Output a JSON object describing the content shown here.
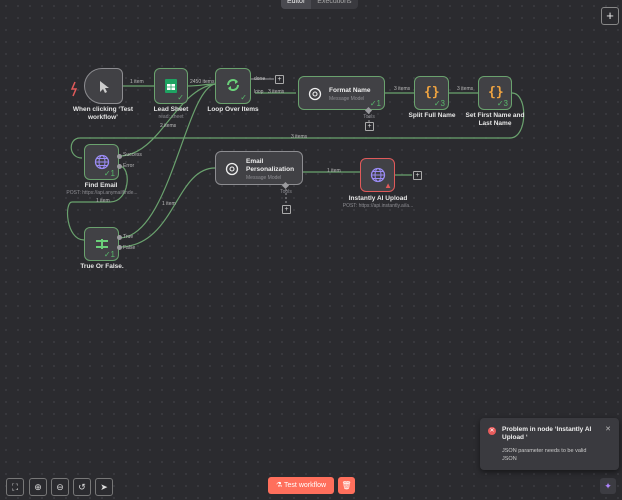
{
  "tabs": [
    "Editor",
    "Executions"
  ],
  "nodes": {
    "trigger": {
      "label": "When clicking ‘Test workflow’",
      "icon": "cursor-icon"
    },
    "lead_sheet": {
      "label": "Lead Sheet",
      "sub": "read: sheet",
      "icon": "google-sheets-icon"
    },
    "loop": {
      "label": "Loop Over Items",
      "icon": "loop-icon"
    },
    "format_name": {
      "title": "Format Name",
      "sub": "Message Model",
      "icon": "openai-icon",
      "count": "1"
    },
    "split_full_name": {
      "label": "Split Full Name",
      "icon": "code-braces-icon",
      "count": "3"
    },
    "set_first_last": {
      "label": "Set First Name and Last Name",
      "icon": "code-braces-icon",
      "count": "3"
    },
    "find_email": {
      "label": "Find Email",
      "sub": "POST: https://api.anymailfinde...",
      "icon": "globe-icon",
      "count": "1",
      "out_success": "Success",
      "out_error": "Error"
    },
    "true_false": {
      "label": "True Or False.",
      "icon": "if-icon",
      "count": "1",
      "out_true": "True",
      "out_false": "False"
    },
    "email_personalization": {
      "title": "Email Personalization",
      "sub": "Message Model",
      "icon": "openai-icon"
    },
    "instantly_upload": {
      "label": "Instantly AI Upload",
      "sub": "POST: https://api.instantly.ai/a...",
      "icon": "globe-icon"
    }
  },
  "edges": {
    "e1": "1 item",
    "e2": "2450 items",
    "loop_done": "done",
    "loop_loop": "loop",
    "e3": "3 items",
    "e4": "3 items",
    "e5": "3 items",
    "e6": "3 items",
    "e7": "2 items",
    "e8": "1 item",
    "e9": "1 item",
    "e10": "1 item"
  },
  "tool_labels": {
    "format": "Tools",
    "email": "Tools"
  },
  "toolbar": {
    "test_workflow": "Test workflow"
  },
  "toast": {
    "title": "Problem in node ‘Instantly AI Upload ‘",
    "body": "JSON parameter needs to be valid JSON"
  },
  "colors": {
    "success": "#58b96b",
    "error": "#e05a5a",
    "primary": "#ff6f5c",
    "node_border": "#8d8d91"
  }
}
